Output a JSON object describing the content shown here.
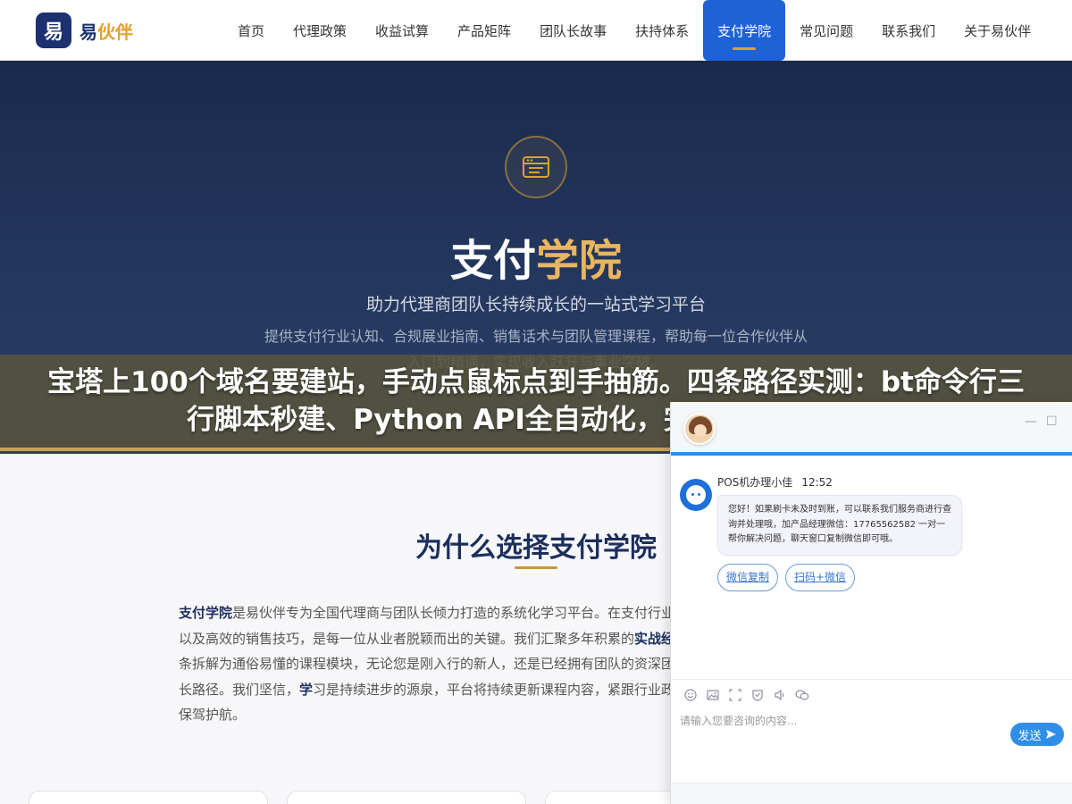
{
  "header": {
    "logo_mark": "易",
    "logo_text_main": "易",
    "logo_text_accent": "伙伴",
    "nav": [
      {
        "label": "首页"
      },
      {
        "label": "代理政策"
      },
      {
        "label": "收益试算"
      },
      {
        "label": "产品矩阵"
      },
      {
        "label": "团队长故事"
      },
      {
        "label": "扶持体系"
      },
      {
        "label": "支付学院",
        "active": true
      },
      {
        "label": "常见问题"
      },
      {
        "label": "联系我们"
      },
      {
        "label": "关于易伙伴"
      }
    ]
  },
  "hero": {
    "title_main": "支付",
    "title_accent": "学院",
    "subtitle": "助力代理商团队长持续成长的一站式学习平台",
    "description": "提供支付行业认知、合规展业指南、销售话术与团队管理课程，帮助每一位合作伙伴从入门到精通，实现收入跃升与事业突破。"
  },
  "overlay": {
    "text": "宝塔上100个域名要建站，手动点鼠标点到手抽筋。四条路径实测：bt命令行三行脚本秒建、Python API全自动化，完整代码直接抄走"
  },
  "why": {
    "title": "为什么选择支付学院",
    "p1_strong": "支付学院",
    "p1_text": "是易伙伴专为全国代理商与团队长倾力打造的系统化学习平台。在支付行业，扎实的行业知识、合规的操作规范以及高效的销售技巧，是每一位从业者脱颖而出的关键。我们汇聚多年积累的",
    "p1_strong2": "实战经验与前沿洞察",
    "p1_text2": "，将复杂的支付产业链条拆解为通俗易懂的课程模块，无论您是刚入行的新人，还是已经拥有团队的资深团队长，都能在这里找到适合自己的成长路径。我们坚信，",
    "p1_strong3": "学",
    "p1_text3": "习是持续进步的源泉，平台将持续更新课程内容，紧跟行业政策变化与市场需求，为您的支付事业保驾护航。"
  },
  "chat": {
    "agent_name": "POS机办理小佳",
    "time": "12:52",
    "message": "您好！如果刷卡未及时到账，可以联系我们服务商进行查询并处理哦，加产品经理微信：17765562582 一对一帮你解决问题，聊天窗口复制微信即可哦。",
    "quick_actions": [
      "微信复制",
      "扫码+微信"
    ],
    "input_placeholder": "请输入您要咨询的内容...",
    "send_label": "发送",
    "minimize": "—",
    "maximize": "☐",
    "tools": [
      "emoji-icon",
      "image-icon",
      "screenshot-icon",
      "rating-icon",
      "voice-icon",
      "wechat-icon"
    ]
  },
  "colors": {
    "brand_navy": "#1c3270",
    "accent_gold": "#e0a030",
    "nav_active": "#1e62d8",
    "chat_blue": "#2e8ee8"
  }
}
